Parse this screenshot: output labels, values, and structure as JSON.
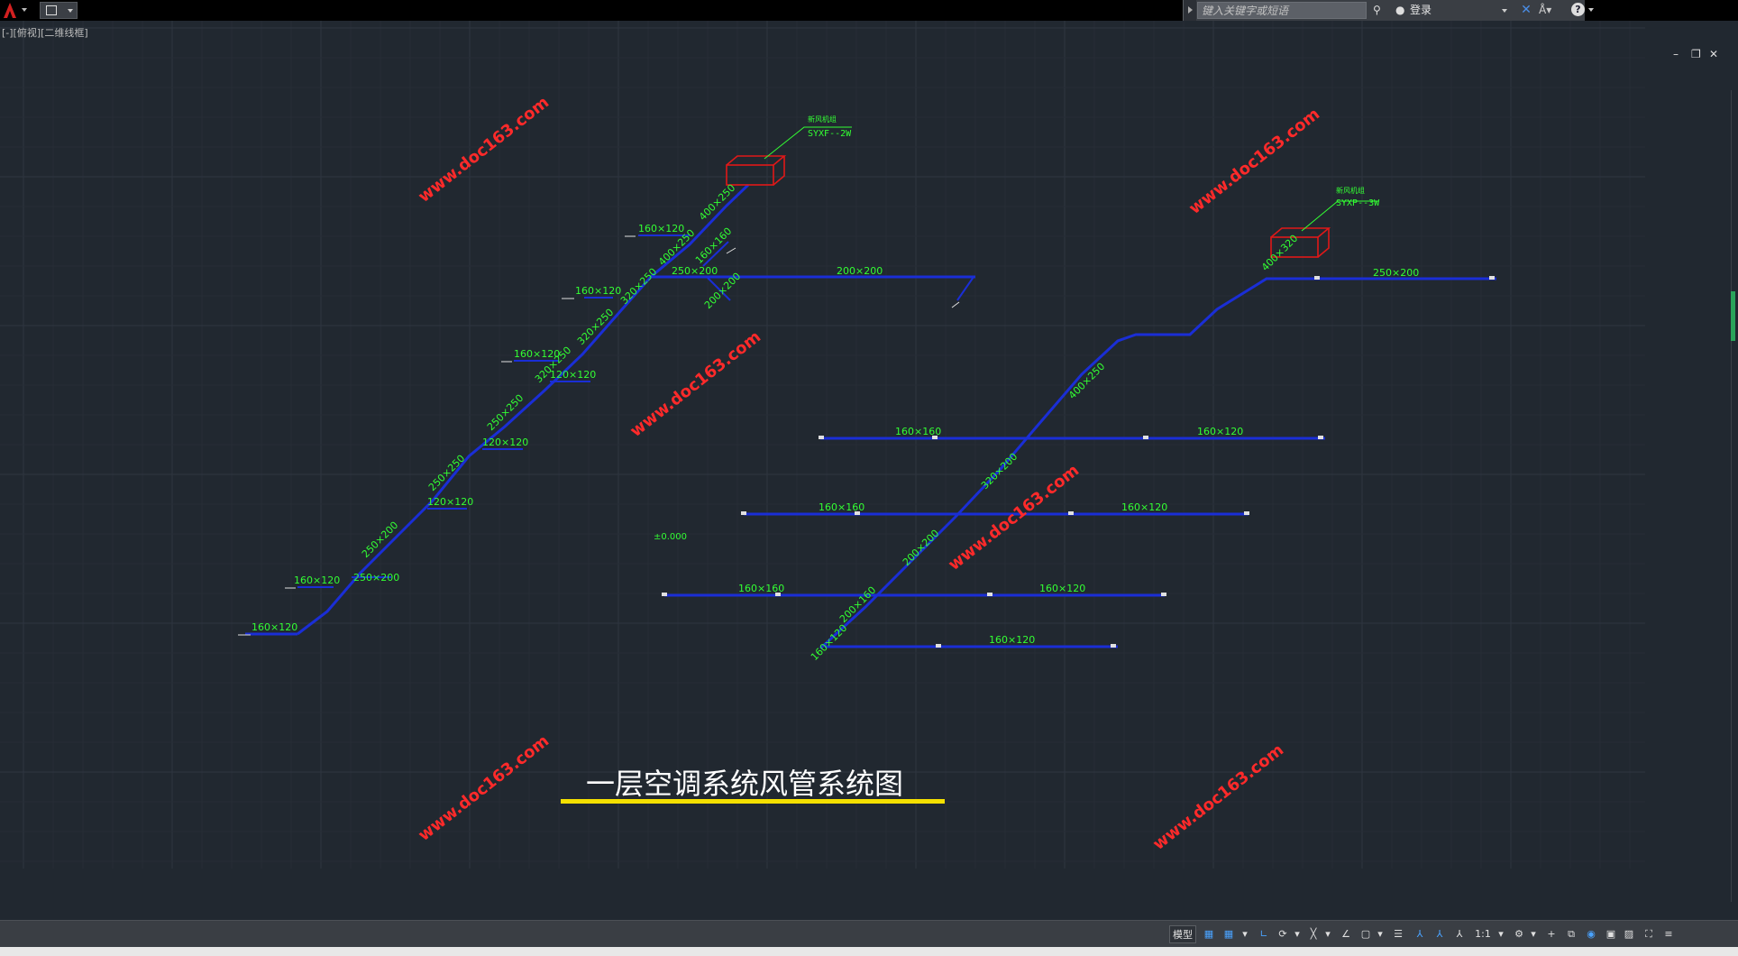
{
  "title_bar": {
    "search_placeholder": "键入关键字或短语",
    "login_label": "登录",
    "help_label": "?"
  },
  "window_controls": {
    "minimize": "–",
    "restore": "❐",
    "close": "✕"
  },
  "viewport": {
    "view_label": "[-][俯视][二维线框]",
    "drawing_title": "一层空调系统风管系统图",
    "watermark": "www.doc163.com",
    "left_unit": {
      "unit_label": "新风机组",
      "unit_code": "SYXF--2W",
      "main_sizes": [
        "400×250",
        "400×250",
        "320×250",
        "320×250",
        "320×250",
        "250×250",
        "250×250",
        "250×200",
        "250×200"
      ],
      "branch_sizes": [
        "160×120",
        "160×160",
        "250×200",
        "200×200",
        "200×200",
        "160×120",
        "160×120",
        "120×120",
        "120×120",
        "120×120",
        "160×120",
        "160×120"
      ]
    },
    "right_unit": {
      "unit_label": "新风机组",
      "unit_code": "SYXP--3W",
      "main_sizes": [
        "400×320",
        "400×250",
        "320×200",
        "200×200",
        "200×160",
        "160×120"
      ],
      "branch_sizes": [
        "250×200",
        "160×160",
        "160×120",
        "160×160",
        "160×120",
        "160×160",
        "160×120",
        "160×120"
      ]
    },
    "elevation": "±0.000"
  },
  "status_bar": {
    "model_label": "模型",
    "scale_label": "1:1"
  },
  "colors": {
    "background": "#212830",
    "duct": "#1a2ed6",
    "dimension_text": "#33ff33",
    "watermark": "#ff2a2a",
    "unit_box": "#e01818",
    "title_underline": "#f5e000"
  }
}
